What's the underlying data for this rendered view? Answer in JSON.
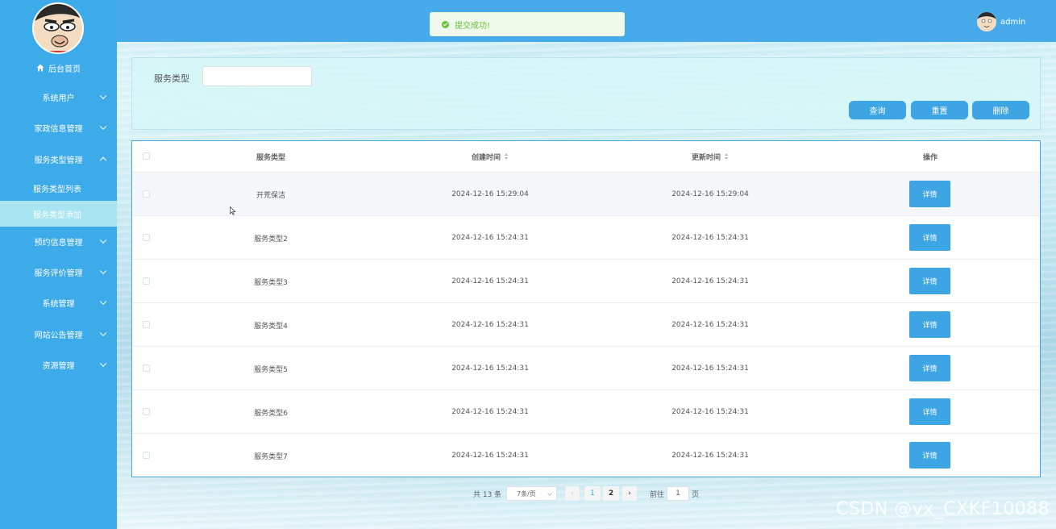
{
  "sidebar": {
    "home_label": "后台首页",
    "items": [
      {
        "label": "系统用户",
        "expanded": false
      },
      {
        "label": "家政信息管理",
        "expanded": false
      },
      {
        "label": "服务类型管理",
        "expanded": true
      },
      {
        "label": "预约信息管理",
        "expanded": false
      },
      {
        "label": "服务评价管理",
        "expanded": false
      },
      {
        "label": "系统管理",
        "expanded": false
      },
      {
        "label": "网站公告管理",
        "expanded": false
      },
      {
        "label": "资源管理",
        "expanded": false
      }
    ],
    "subitems": [
      {
        "label": "服务类型列表",
        "active": false
      },
      {
        "label": "服务类型添加",
        "active": true
      }
    ]
  },
  "header": {
    "toast": "提交成功!",
    "username": "admin"
  },
  "search": {
    "label": "服务类型",
    "value": "",
    "query_button": "查询",
    "reset_button": "重置",
    "delete_button": "删除"
  },
  "table": {
    "columns": [
      "服务类型",
      "创建时间",
      "更新时间",
      "操作"
    ],
    "rows": [
      {
        "type": "开荒保洁",
        "created": "2024-12-16 15:29:04",
        "updated": "2024-12-16 15:29:04",
        "action": "详情"
      },
      {
        "type": "服务类型2",
        "created": "2024-12-16 15:24:31",
        "updated": "2024-12-16 15:24:31",
        "action": "详情"
      },
      {
        "type": "服务类型3",
        "created": "2024-12-16 15:24:31",
        "updated": "2024-12-16 15:24:31",
        "action": "详情"
      },
      {
        "type": "服务类型4",
        "created": "2024-12-16 15:24:31",
        "updated": "2024-12-16 15:24:31",
        "action": "详情"
      },
      {
        "type": "服务类型5",
        "created": "2024-12-16 15:24:31",
        "updated": "2024-12-16 15:24:31",
        "action": "详情"
      },
      {
        "type": "服务类型6",
        "created": "2024-12-16 15:24:31",
        "updated": "2024-12-16 15:24:31",
        "action": "详情"
      },
      {
        "type": "服务类型7",
        "created": "2024-12-16 15:24:31",
        "updated": "2024-12-16 15:24:31",
        "action": "详情"
      }
    ]
  },
  "pagination": {
    "total": "共 13 条",
    "page_size": "7条/页",
    "pages": [
      "1",
      "2"
    ],
    "current_page": "1",
    "goto_label": "前往",
    "goto_value": "1",
    "page_suffix": "页"
  },
  "watermark": "CSDN @vx_CXKF10088",
  "colors": {
    "sidebar": "#3daaea",
    "topbar": "#47abeb",
    "primary_button": "#3da5e4",
    "success": "#67c23a"
  }
}
